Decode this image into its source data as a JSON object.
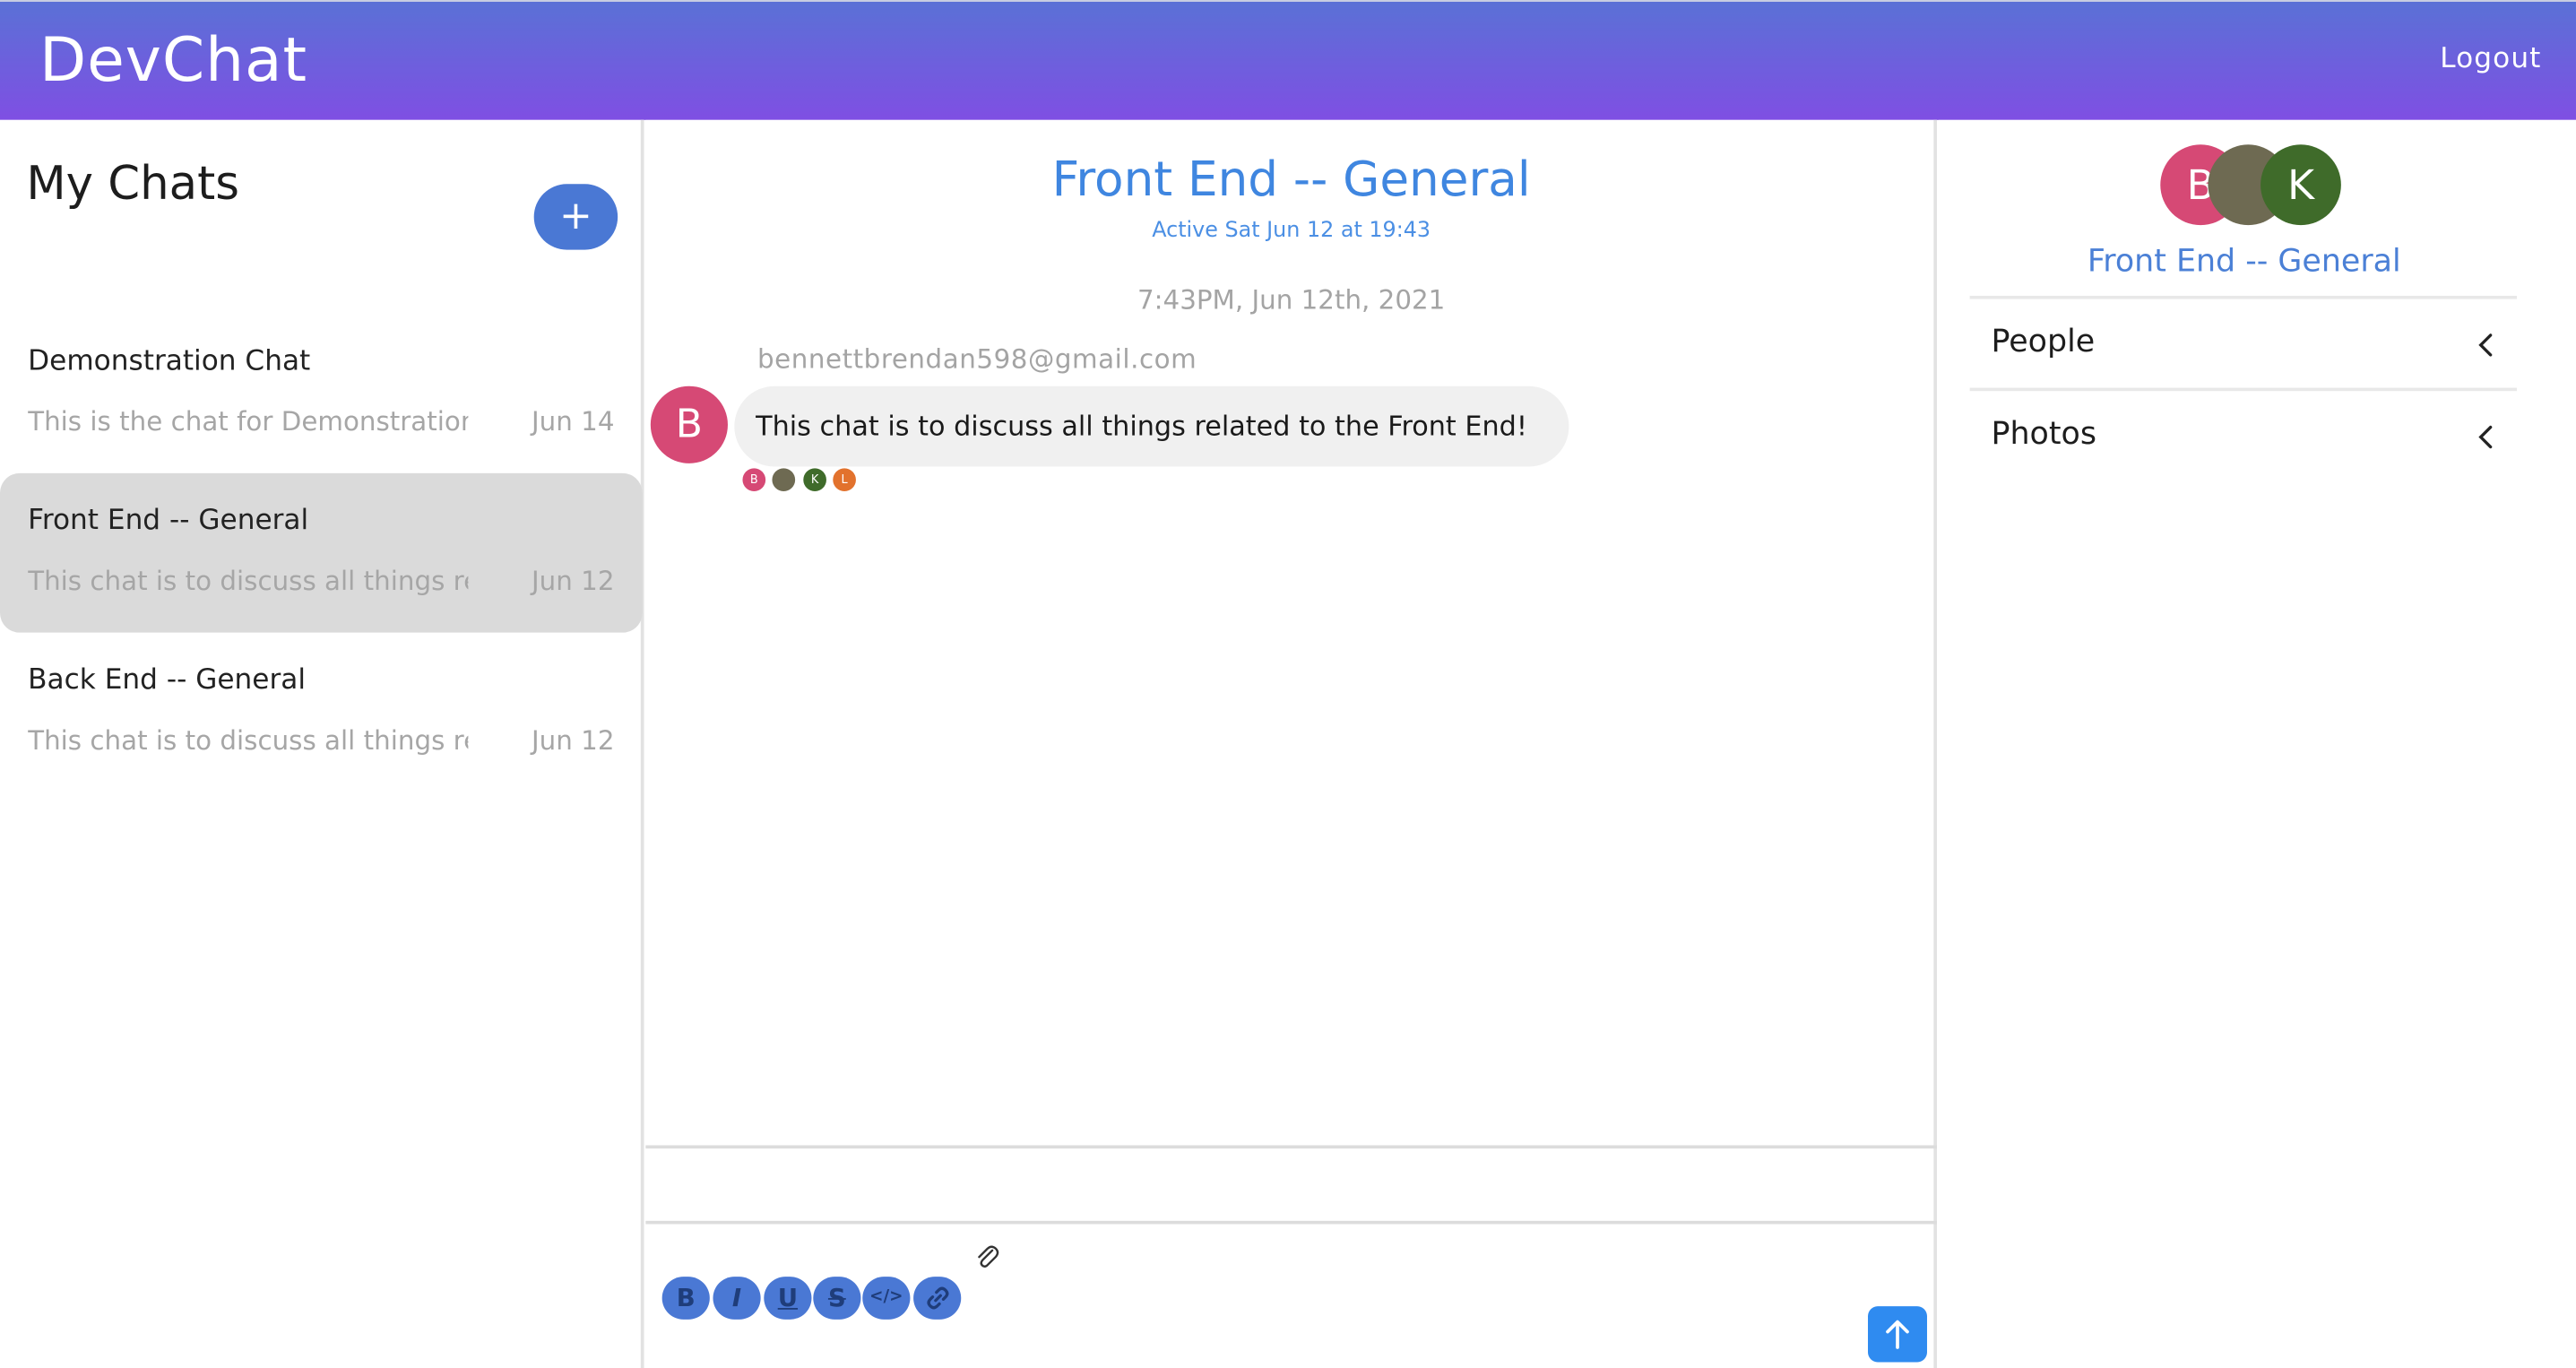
{
  "header": {
    "brand": "DevChat",
    "logout_label": "Logout"
  },
  "sidebar": {
    "title": "My Chats",
    "new_chat_label": "+",
    "chats": [
      {
        "name": "Demonstration Chat",
        "preview": "This is the chat for Demonstration",
        "date": "Jun 14",
        "active": false
      },
      {
        "name": "Front End -- General",
        "preview": "This chat is to discuss all things related to the Front End!",
        "date": "Jun 12",
        "active": true
      },
      {
        "name": "Back End -- General",
        "preview": "This chat is to discuss all things related to the Back End!",
        "date": "Jun 12",
        "active": false
      }
    ]
  },
  "feed": {
    "title": "Front End -- General",
    "subtitle": "Active Sat Jun 12 at 19:43",
    "timestamp": "7:43PM, Jun 12th, 2021",
    "message": {
      "sender": "bennettbrendan598@gmail.com",
      "avatar_letter": "B",
      "text": "This chat is to discuss all things related to the Front End!"
    },
    "read_receipts": [
      {
        "letter": "B",
        "color": "#d64975"
      },
      {
        "letter": "",
        "color": "#6e6a52"
      },
      {
        "letter": "K",
        "color": "#3f6b2a"
      },
      {
        "letter": "L",
        "color": "#e2722d"
      }
    ],
    "toolbar": [
      "bold-icon",
      "italic-icon",
      "underline-icon",
      "strikethrough-icon",
      "code-icon",
      "link-icon"
    ]
  },
  "settings": {
    "avatars": [
      {
        "letter": "B",
        "color": "#d64975"
      },
      {
        "letter": "",
        "color": "#6e6a52"
      },
      {
        "letter": "K",
        "color": "#3f6b2a"
      }
    ],
    "title": "Front End -- General",
    "sections": [
      {
        "label": "People"
      },
      {
        "label": "Photos"
      }
    ]
  },
  "colors": {
    "header_start": "#5a71d6",
    "header_end": "#7f4fe3",
    "accent_blue": "#4a78d4",
    "title_blue": "#3f86e0",
    "send_blue": "#2f8bf0"
  }
}
